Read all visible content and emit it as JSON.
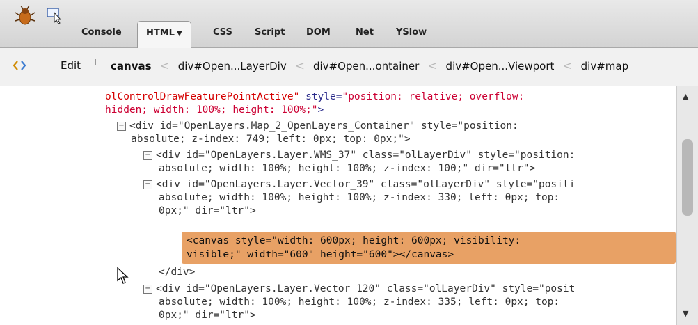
{
  "toolbar": {
    "tabs": [
      {
        "label": "Console"
      },
      {
        "label": "HTML",
        "dropdown": "▼",
        "active": true
      },
      {
        "label": "CSS"
      },
      {
        "label": "Script"
      },
      {
        "label": "DOM"
      },
      {
        "label": "Net"
      },
      {
        "label": "YSlow"
      }
    ]
  },
  "breadcrumb": {
    "edit_label": "Edit",
    "items": [
      "canvas",
      "div#Open...LayerDiv",
      "div#Open...ontainer",
      "div#Open...Viewport",
      "div#map"
    ],
    "separator": "<"
  },
  "code": {
    "line0_red": "olControlDrawFeaturePointActive\"",
    "line0_attr": " style=",
    "line0_val": "\"position: relative; overflow:",
    "line1_val": "hidden; width: 100%; height: 100%;\"",
    "line1_end": ">",
    "line2": "<div id=\"OpenLayers.Map_2_OpenLayers_Container\" style=\"position:",
    "line3": "absolute; z-index: 749; left: 0px; top: 0px;\">",
    "line4": "<div id=\"OpenLayers.Layer.WMS_37\" class=\"olLayerDiv\" style=\"position:",
    "line5": "absolute; width: 100%; height: 100%; z-index: 100;\" dir=\"ltr\">",
    "line6": "<div id=\"OpenLayers.Layer.Vector_39\" class=\"olLayerDiv\" style=\"positi",
    "line7": "absolute; width: 100%; height: 100%; z-index: 330; left: 0px; top:",
    "line8": "0px;\" dir=\"ltr\">",
    "line9": "<canvas style=\"width: 600px; height: 600px; visibility:",
    "line10": "visible;\" width=\"600\" height=\"600\"></canvas>",
    "line11": "</div>",
    "line12": "<div id=\"OpenLayers.Layer.Vector_120\" class=\"olLayerDiv\" style=\"posit",
    "line13": "absolute; width: 100%; height: 100%; z-index: 335; left: 0px; top:",
    "line14": "0px;\" dir=\"ltr\">",
    "toggle_minus": "−",
    "toggle_plus": "+"
  },
  "scrollbar": {
    "up": "▲",
    "down": "▼"
  },
  "colors": {
    "highlight": "#e8a165",
    "attr_value": "#c03",
    "selected_red": "#d50000"
  }
}
